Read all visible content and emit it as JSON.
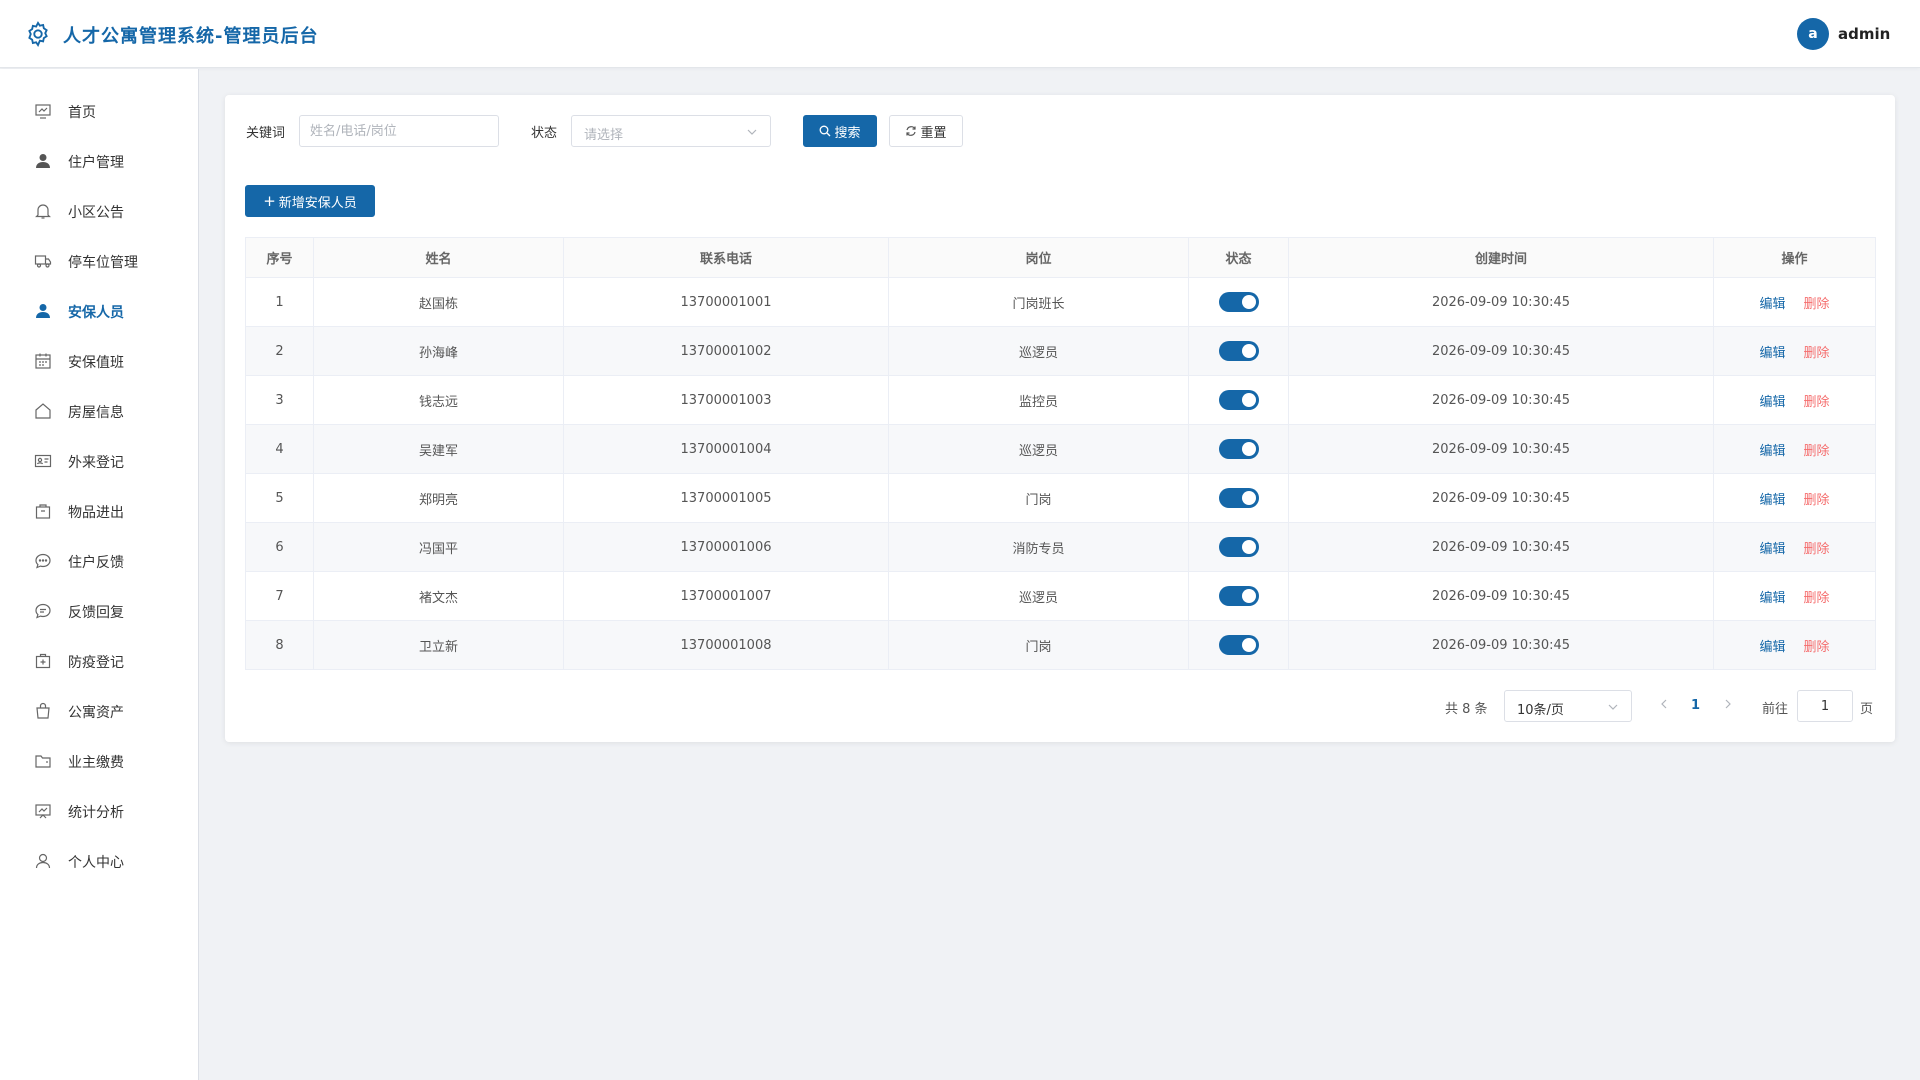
{
  "header": {
    "title": "人才公寓管理系统-管理员后台",
    "user": {
      "avatar_letter": "a",
      "name": "admin"
    }
  },
  "sidebar": {
    "items": [
      {
        "label": "首页",
        "icon": "dashboard-icon"
      },
      {
        "label": "住户管理",
        "icon": "user-icon"
      },
      {
        "label": "小区公告",
        "icon": "bell-icon"
      },
      {
        "label": "停车位管理",
        "icon": "truck-icon"
      },
      {
        "label": "安保人员",
        "icon": "user-icon",
        "active": true
      },
      {
        "label": "安保值班",
        "icon": "calendar-icon"
      },
      {
        "label": "房屋信息",
        "icon": "house-icon"
      },
      {
        "label": "外来登记",
        "icon": "id-card-icon"
      },
      {
        "label": "物品进出",
        "icon": "box-icon"
      },
      {
        "label": "住户反馈",
        "icon": "chat-icon"
      },
      {
        "label": "反馈回复",
        "icon": "chat-reply-icon"
      },
      {
        "label": "防疫登记",
        "icon": "first-aid-icon"
      },
      {
        "label": "公寓资产",
        "icon": "bag-icon"
      },
      {
        "label": "业主缴费",
        "icon": "folder-icon"
      },
      {
        "label": "统计分析",
        "icon": "chart-board-icon"
      },
      {
        "label": "个人中心",
        "icon": "profile-icon"
      }
    ]
  },
  "filters": {
    "keyword_label": "关键词",
    "keyword_placeholder": "姓名/电话/岗位",
    "keyword_value": "",
    "status_label": "状态",
    "status_placeholder": "请选择",
    "search_label": "搜索",
    "reset_label": "重置"
  },
  "add_button_label": "新增安保人员",
  "table": {
    "columns": [
      "序号",
      "姓名",
      "联系电话",
      "岗位",
      "状态",
      "创建时间",
      "操作"
    ],
    "rows": [
      {
        "no": "1",
        "name": "赵国栋",
        "phone": "13700001001",
        "post": "门岗班长",
        "status": true,
        "created": "2026-09-09 10:30:45"
      },
      {
        "no": "2",
        "name": "孙海峰",
        "phone": "13700001002",
        "post": "巡逻员",
        "status": true,
        "created": "2026-09-09 10:30:45"
      },
      {
        "no": "3",
        "name": "钱志远",
        "phone": "13700001003",
        "post": "监控员",
        "status": true,
        "created": "2026-09-09 10:30:45"
      },
      {
        "no": "4",
        "name": "吴建军",
        "phone": "13700001004",
        "post": "巡逻员",
        "status": true,
        "created": "2026-09-09 10:30:45"
      },
      {
        "no": "5",
        "name": "郑明亮",
        "phone": "13700001005",
        "post": "门岗",
        "status": true,
        "created": "2026-09-09 10:30:45"
      },
      {
        "no": "6",
        "name": "冯国平",
        "phone": "13700001006",
        "post": "消防专员",
        "status": true,
        "created": "2026-09-09 10:30:45"
      },
      {
        "no": "7",
        "name": "褚文杰",
        "phone": "13700001007",
        "post": "巡逻员",
        "status": true,
        "created": "2026-09-09 10:30:45"
      },
      {
        "no": "8",
        "name": "卫立新",
        "phone": "13700001008",
        "post": "门岗",
        "status": true,
        "created": "2026-09-09 10:30:45"
      }
    ],
    "edit_label": "编辑",
    "delete_label": "删除"
  },
  "pagination": {
    "total_text": "共 8 条",
    "page_size": "10条/页",
    "current_page": "1",
    "goto_label": "前往",
    "goto_value": "1",
    "page_suffix": "页"
  },
  "colors": {
    "primary": "#1567a8",
    "danger": "#f56c6c",
    "background": "#f0f2f5"
  }
}
